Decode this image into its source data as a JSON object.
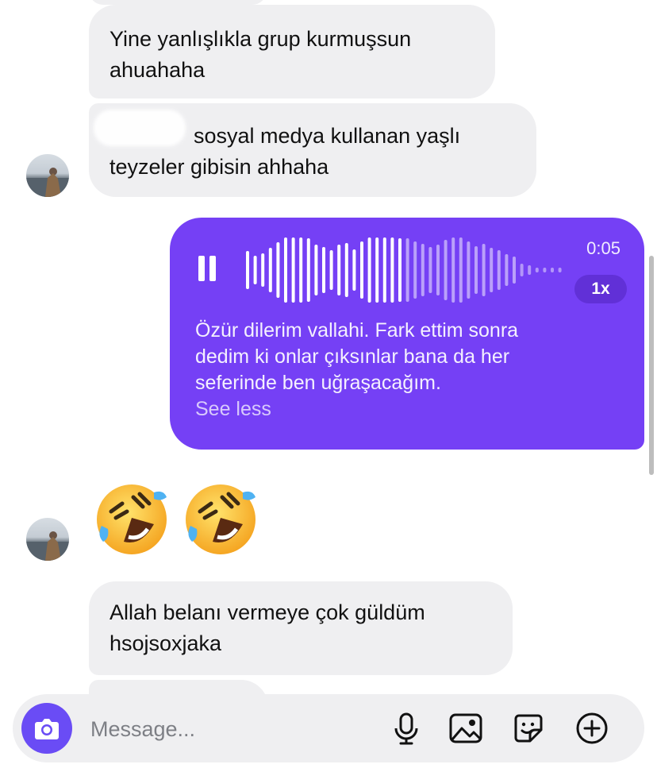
{
  "messages": {
    "m1": {
      "line1": "Yine yanlışlıkla grup kurmuşsun",
      "line2": "ahuahaha"
    },
    "m2": {
      "line1": "sosyal medya kullanan yaşlı",
      "line2": "teyzeler gibisin ahhaha"
    },
    "voice": {
      "duration": "0:05",
      "speed": "1x",
      "playback_progress_fraction": 0.58,
      "transcript_line1": "Özür dilerim vallahi. Fark ettim sonra",
      "transcript_line2": "dedim ki onlar çıksınlar bana da her",
      "transcript_line3": "seferinde ben uğraşacağım.",
      "see_less": "See less"
    },
    "emoji_reaction": [
      "rolling-on-floor-laughing",
      "rolling-on-floor-laughing"
    ],
    "m3": {
      "line1": "Allah belanı vermeye çok güldüm",
      "line2": "hsojsoxjaka"
    }
  },
  "composer": {
    "placeholder": "Message..."
  },
  "colors": {
    "incoming_bubble": "#EFEFF1",
    "outgoing_voice_bubble": "#7540F5",
    "camera_button": "#6A4CF5"
  }
}
